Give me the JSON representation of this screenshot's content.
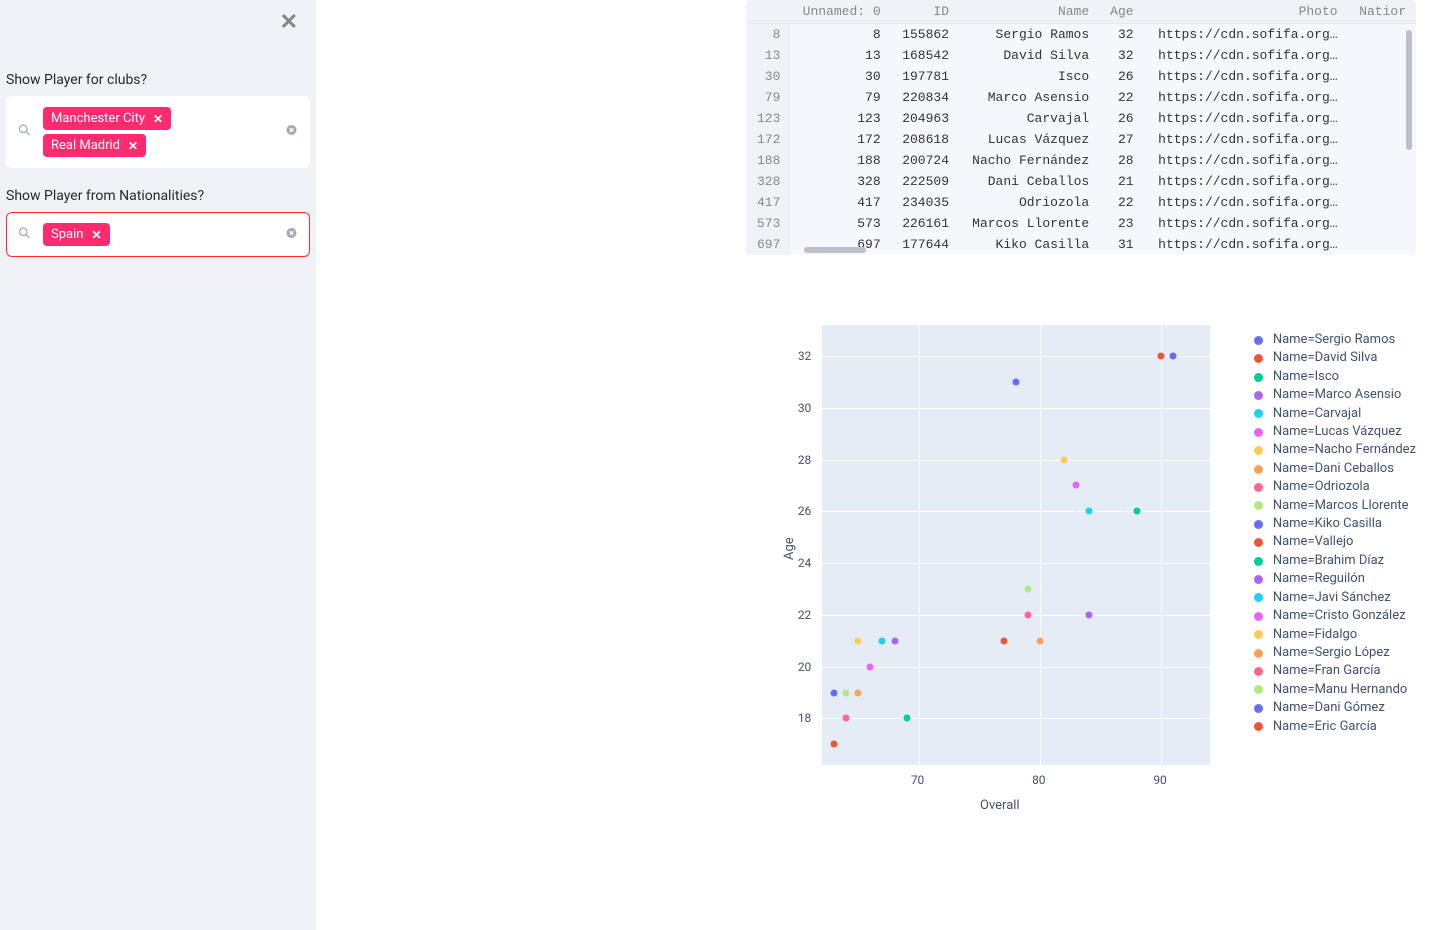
{
  "sidebar": {
    "label_clubs": "Show Player for clubs?",
    "label_nats": "Show Player from Nationalities?",
    "clubs": [
      "Manchester City",
      "Real Madrid"
    ],
    "nationalities": [
      "Spain"
    ]
  },
  "table": {
    "headers": [
      "Unnamed: 0",
      "ID",
      "Name",
      "Age",
      "Photo",
      "Natior"
    ],
    "rows": [
      {
        "idx": "8",
        "u": "8",
        "id": "155862",
        "name": "Sergio Ramos",
        "age": "32",
        "photo": "https://cdn.sofifa.org…"
      },
      {
        "idx": "13",
        "u": "13",
        "id": "168542",
        "name": "David Silva",
        "age": "32",
        "photo": "https://cdn.sofifa.org…"
      },
      {
        "idx": "30",
        "u": "30",
        "id": "197781",
        "name": "Isco",
        "age": "26",
        "photo": "https://cdn.sofifa.org…"
      },
      {
        "idx": "79",
        "u": "79",
        "id": "220834",
        "name": "Marco Asensio",
        "age": "22",
        "photo": "https://cdn.sofifa.org…"
      },
      {
        "idx": "123",
        "u": "123",
        "id": "204963",
        "name": "Carvajal",
        "age": "26",
        "photo": "https://cdn.sofifa.org…"
      },
      {
        "idx": "172",
        "u": "172",
        "id": "208618",
        "name": "Lucas Vázquez",
        "age": "27",
        "photo": "https://cdn.sofifa.org…"
      },
      {
        "idx": "188",
        "u": "188",
        "id": "200724",
        "name": "Nacho Fernández",
        "age": "28",
        "photo": "https://cdn.sofifa.org…"
      },
      {
        "idx": "328",
        "u": "328",
        "id": "222509",
        "name": "Dani Ceballos",
        "age": "21",
        "photo": "https://cdn.sofifa.org…"
      },
      {
        "idx": "417",
        "u": "417",
        "id": "234035",
        "name": "Odriozola",
        "age": "22",
        "photo": "https://cdn.sofifa.org…"
      },
      {
        "idx": "573",
        "u": "573",
        "id": "226161",
        "name": "Marcos Llorente",
        "age": "23",
        "photo": "https://cdn.sofifa.org…"
      },
      {
        "idx": "697",
        "u": "697",
        "id": "177644",
        "name": "Kiko Casilla",
        "age": "31",
        "photo": "https://cdn.sofifa.org…"
      }
    ]
  },
  "chart_data": {
    "type": "scatter",
    "title": "",
    "xlabel": "Overall",
    "ylabel": "Age",
    "xlim": [
      62,
      94
    ],
    "ylim": [
      16.2,
      33.2
    ],
    "xticks": [
      70,
      80,
      90
    ],
    "yticks": [
      18,
      20,
      22,
      24,
      26,
      28,
      30,
      32
    ],
    "series": [
      {
        "name": "Name=Sergio Ramos",
        "color": "#636efa",
        "points": [
          {
            "x": 91,
            "y": 32
          }
        ]
      },
      {
        "name": "Name=David Silva",
        "color": "#ef553b",
        "points": [
          {
            "x": 90,
            "y": 32
          }
        ]
      },
      {
        "name": "Name=Isco",
        "color": "#00cc96",
        "points": [
          {
            "x": 88,
            "y": 26
          }
        ]
      },
      {
        "name": "Name=Marco Asensio",
        "color": "#ab63fa",
        "points": [
          {
            "x": 84,
            "y": 22
          }
        ]
      },
      {
        "name": "Name=Carvajal",
        "color": "#19d3f3",
        "points": [
          {
            "x": 84,
            "y": 26
          }
        ]
      },
      {
        "name": "Name=Lucas Vázquez",
        "color": "#e763fa",
        "points": [
          {
            "x": 83,
            "y": 27
          }
        ]
      },
      {
        "name": "Name=Nacho Fernández",
        "color": "#fecb52",
        "points": [
          {
            "x": 82,
            "y": 28
          }
        ]
      },
      {
        "name": "Name=Dani Ceballos",
        "color": "#ffa15a",
        "points": [
          {
            "x": 80,
            "y": 21
          }
        ]
      },
      {
        "name": "Name=Odriozola",
        "color": "#ff6692",
        "points": [
          {
            "x": 79,
            "y": 22
          }
        ]
      },
      {
        "name": "Name=Marcos Llorente",
        "color": "#b6e880",
        "points": [
          {
            "x": 79,
            "y": 23
          }
        ]
      },
      {
        "name": "Name=Kiko Casilla",
        "color": "#636efa",
        "points": [
          {
            "x": 78,
            "y": 31
          }
        ]
      },
      {
        "name": "Name=Vallejo",
        "color": "#ef553b",
        "points": [
          {
            "x": 77,
            "y": 21
          }
        ]
      },
      {
        "name": "Name=Brahim Díaz",
        "color": "#00cc96",
        "points": [
          {
            "x": 69,
            "y": 18
          }
        ]
      },
      {
        "name": "Name=Reguilón",
        "color": "#ab63fa",
        "points": [
          {
            "x": 68,
            "y": 21
          }
        ]
      },
      {
        "name": "Name=Javi Sánchez",
        "color": "#19d3f3",
        "points": [
          {
            "x": 67,
            "y": 21
          }
        ]
      },
      {
        "name": "Name=Cristo González",
        "color": "#e763fa",
        "points": [
          {
            "x": 66,
            "y": 20
          }
        ]
      },
      {
        "name": "Name=Fidalgo",
        "color": "#fecb52",
        "points": [
          {
            "x": 65,
            "y": 21
          }
        ]
      },
      {
        "name": "Name=Sergio López",
        "color": "#ffa15a",
        "points": [
          {
            "x": 65,
            "y": 19
          }
        ]
      },
      {
        "name": "Name=Fran García",
        "color": "#ff6692",
        "points": [
          {
            "x": 64,
            "y": 18
          }
        ]
      },
      {
        "name": "Name=Manu Hernando",
        "color": "#b6e880",
        "points": [
          {
            "x": 64,
            "y": 19
          }
        ]
      },
      {
        "name": "Name=Dani Gómez",
        "color": "#636efa",
        "points": [
          {
            "x": 63,
            "y": 19
          }
        ]
      },
      {
        "name": "Name=Eric García",
        "color": "#ef553b",
        "points": [
          {
            "x": 63,
            "y": 17
          }
        ]
      }
    ]
  }
}
